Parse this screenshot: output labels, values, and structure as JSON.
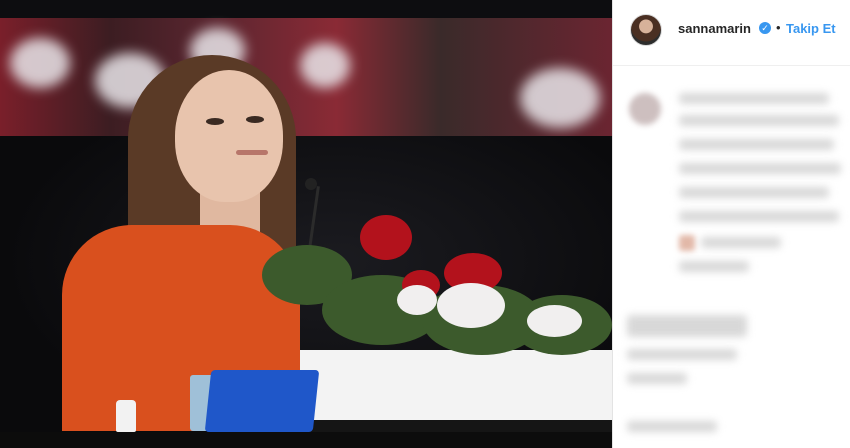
{
  "post": {
    "username": "sannamarin",
    "verified_mark": "✓",
    "separator": "•",
    "follow_label": "Takip Et"
  },
  "colors": {
    "follow": "#3897f0",
    "verified": "#3897f0",
    "username": "#262626",
    "shirt": "#d9501e"
  },
  "icons": {
    "verified": "verified-badge-icon",
    "avatar": "profile-avatar"
  }
}
